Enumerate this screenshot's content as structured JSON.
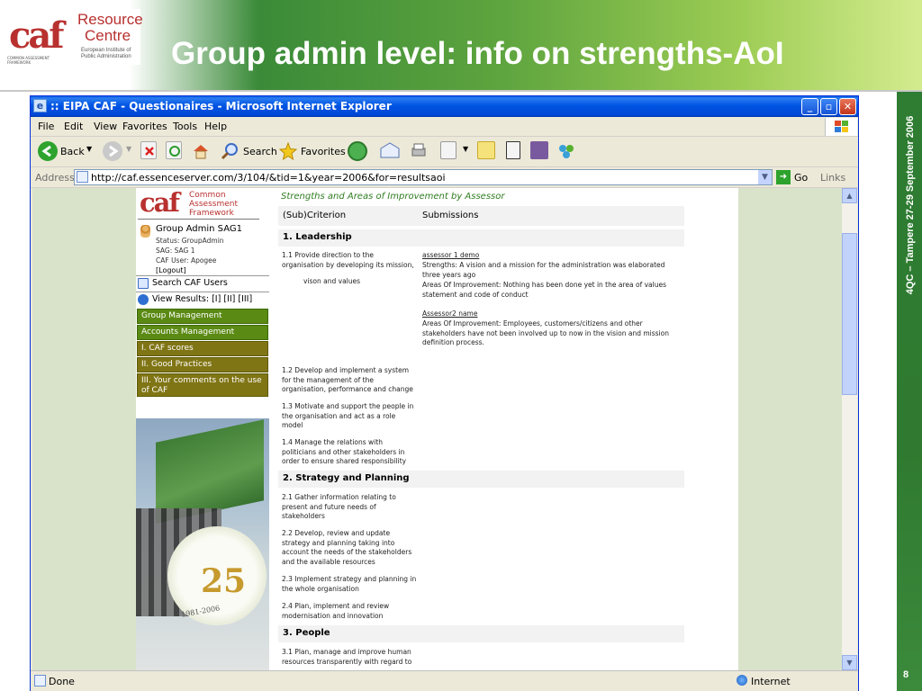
{
  "slide": {
    "logo": {
      "mark": "caf",
      "line1": "Resource",
      "line2": "Centre",
      "sub": "European Institute of Public Administration",
      "small": "COMMON ASSESSMENT FRAMEWORK"
    },
    "title": "Group admin level: info on strengths-AoI",
    "side_text": "4QC – Tampere 27-29 September 2006",
    "page_number": "8",
    "colors": {
      "banner_green": "#3a8a38",
      "sidebar_green": "#2e7d32",
      "logo_red": "#b8312f"
    }
  },
  "browser": {
    "title": ":: EIPA CAF - Questionaires - Microsoft Internet Explorer",
    "menu": [
      "File",
      "Edit",
      "View",
      "Favorites",
      "Tools",
      "Help"
    ],
    "toolbar": {
      "back": "Back",
      "search": "Search",
      "favorites": "Favorites"
    },
    "address_label": "Address",
    "url": "http://caf.essenceserver.com/3/104/&tid=1&year=2006&for=resultsaoi",
    "go": "Go",
    "links": "Links",
    "status": "Done",
    "zone": "Internet"
  },
  "nav": {
    "logo_text": "Common Assessment Framework",
    "user_name": "Group Admin SAG1",
    "status": "Status: GroupAdmin",
    "sag": "SAG: SAG 1",
    "caf_user": "CAF User: Apogee",
    "logout": "[Logout]",
    "search": "Search CAF Users",
    "view_results": "View Results: [I] [II] [III]",
    "items": [
      "Group Management",
      "Accounts Management",
      "I. CAF scores",
      "II. Good Practices",
      "III. Your comments on the use of CAF"
    ],
    "anniversary": "25",
    "anniversary_years": "1981-2006"
  },
  "content": {
    "heading": "Strengths and Areas of Improvement by Assessor",
    "col1": "(Sub)Criterion",
    "col2": "Submissions",
    "sections": [
      "1. Leadership",
      "2. Strategy and Planning",
      "3. People"
    ],
    "criteria": [
      "1.1 Provide direction to the organisation by developing its mission,",
      "vison and values",
      "1.2 Develop and implement a system for the management of the organisation, performance and change",
      "1.3 Motivate and support the people in the organisation and act as a role model",
      "1.4 Manage the relations with politicians and other stakeholders in order to ensure shared responsibility",
      "2.1 Gather information relating to present and future needs of stakeholders",
      "2.2 Develop, review and update strategy and planning taking into account the needs of the stakeholders and the available resources",
      "2.3 Implement strategy and planning in the whole organisation",
      "2.4 Plan, implement and review modernisation and innovation",
      "3.1 Plan, manage and improve human resources transparently with regard to"
    ],
    "assessor1": "assessor 1 demo",
    "a1_strengths": "Strengths: A vision and a mission for the administration was elaborated three years ago",
    "a1_aoi": "Areas Of Improvement: Nothing has been done yet in the area of values statement and code of conduct",
    "assessor2": "Assessor2 name",
    "a2_aoi": "Areas Of Improvement: Employees, customers/citizens and other stakeholders have not been involved up to now in the vision and mission definition process."
  }
}
